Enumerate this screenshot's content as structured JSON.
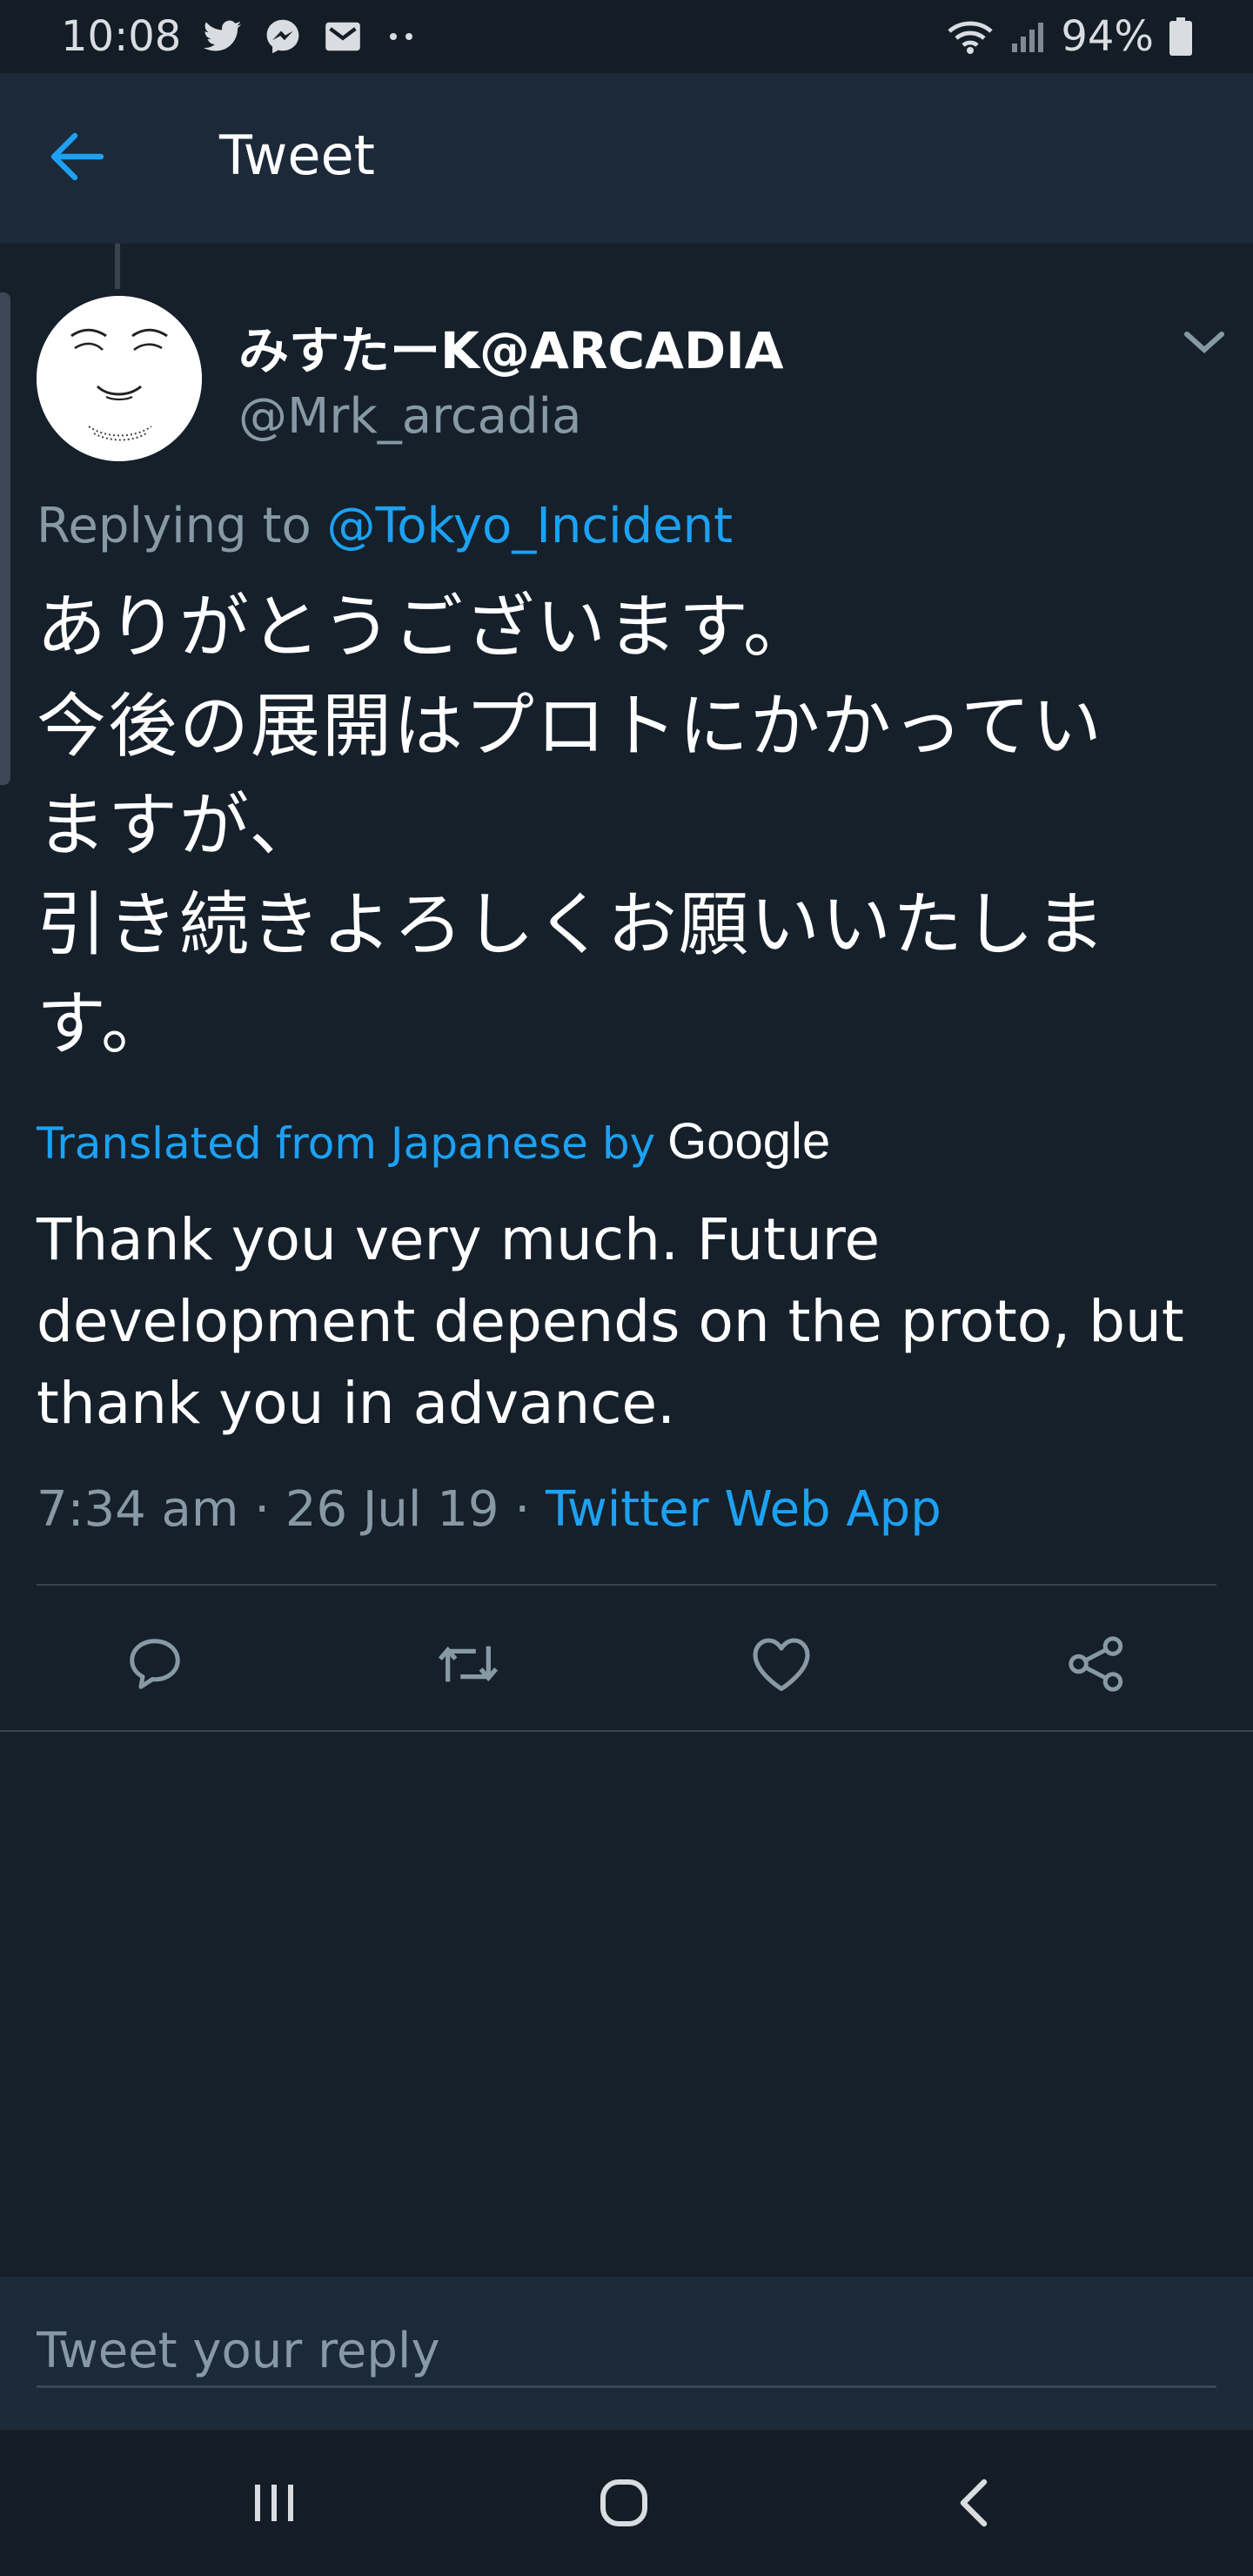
{
  "status_bar": {
    "time": "10:08",
    "battery": "94%",
    "left_icons": [
      "twitter-icon",
      "messenger-icon",
      "mail-icon",
      "more-dots-icon"
    ],
    "right_icons": [
      "wifi-icon",
      "signal-icon",
      "battery-icon"
    ]
  },
  "app_bar": {
    "title": "Tweet",
    "back_icon": "arrow-left-icon"
  },
  "tweet": {
    "display_name": "みすたーK@ARCADIA",
    "handle": "@Mrk_arcadia",
    "replying_prefix": "Replying to",
    "replying_to": "@Tokyo_Incident",
    "text": "ありがとうございます。\n今後の展開はプロトにかかってい\nますが、\n引き続きよろしくお願いいたしま\nす。",
    "translated_label": "Translated from Japanese by",
    "translator": "Google",
    "translation": "Thank you very much. Future development depends on the proto, but thank you in advance.",
    "time": "7:34 am",
    "date": "26 Jul 19",
    "source": "Twitter Web App",
    "separator": "·"
  },
  "actions": [
    "reply-icon",
    "retweet-icon",
    "like-icon",
    "share-icon"
  ],
  "reply_box": {
    "placeholder": "Tweet your reply"
  },
  "nav_bar": [
    "recents-icon",
    "home-icon",
    "back-icon"
  ],
  "colors": {
    "background": "#15202b",
    "bar": "#1c2938",
    "accent": "#1da1f2",
    "secondary_text": "#8899a6"
  }
}
